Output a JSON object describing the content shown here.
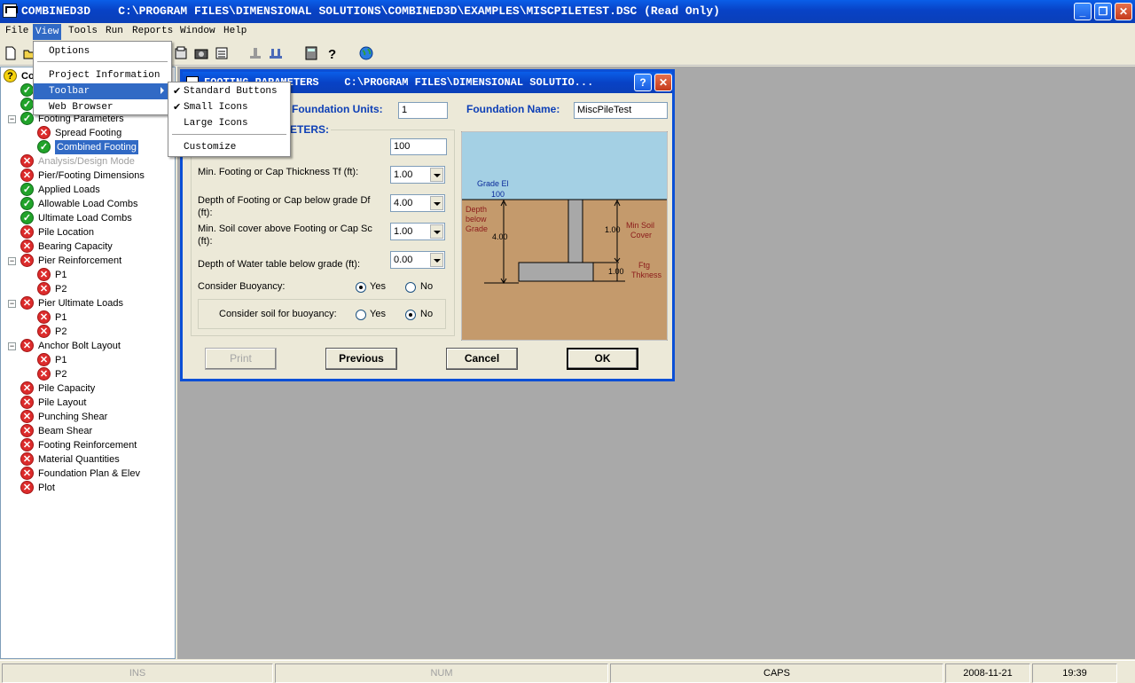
{
  "window": {
    "title": "COMBINED3D    C:\\PROGRAM FILES\\DIMENSIONAL SOLUTIONS\\COMBINED3D\\EXAMPLES\\MISCPILETEST.DSC (Read Only)"
  },
  "menubar": [
    "File",
    "View",
    "Tools",
    "Run",
    "Reports",
    "Window",
    "Help"
  ],
  "view_menu": {
    "items": [
      "Options",
      "Project Information",
      "Toolbar",
      "Web Browser"
    ]
  },
  "toolbar_submenu": {
    "items": [
      {
        "label": "Standard Buttons",
        "checked": true
      },
      {
        "label": "Small Icons",
        "checked": true
      },
      {
        "label": "Large Icons",
        "checked": false
      },
      {
        "label": "Customize",
        "checked": false
      }
    ]
  },
  "tree": {
    "root": "Co",
    "items": [
      {
        "label": "Footing Parameters",
        "status": "ok",
        "level": 1
      },
      {
        "label": "Spread Footing",
        "status": "x",
        "level": 2
      },
      {
        "label": "Combined Footing",
        "status": "ok",
        "level": 2
      },
      {
        "label": "Analysis/Design Mode",
        "status": "x",
        "level": 1
      },
      {
        "label": "Pier/Footing Dimensions",
        "status": "x",
        "level": 1
      },
      {
        "label": "Applied Loads",
        "status": "ok",
        "level": 1
      },
      {
        "label": "Allowable Load Combs",
        "status": "ok",
        "level": 1
      },
      {
        "label": "Ultimate Load Combs",
        "status": "ok",
        "level": 1
      },
      {
        "label": "Pile Location",
        "status": "x",
        "level": 1
      },
      {
        "label": "Bearing Capacity",
        "status": "x",
        "level": 1
      },
      {
        "label": "Pier Reinforcement",
        "status": "x",
        "level": 1
      },
      {
        "label": "P1",
        "status": "x",
        "level": 2
      },
      {
        "label": "P2",
        "status": "x",
        "level": 2
      },
      {
        "label": "Pier Ultimate Loads",
        "status": "x",
        "level": 1
      },
      {
        "label": "P1",
        "status": "x",
        "level": 2
      },
      {
        "label": "P2",
        "status": "x",
        "level": 2
      },
      {
        "label": "Anchor Bolt Layout",
        "status": "x",
        "level": 1
      },
      {
        "label": "P1",
        "status": "x",
        "level": 2
      },
      {
        "label": "P2",
        "status": "x",
        "level": 2
      },
      {
        "label": "Pile Capacity",
        "status": "x",
        "level": 1
      },
      {
        "label": "Pile Layout",
        "status": "x",
        "level": 1
      },
      {
        "label": "Punching Shear",
        "status": "x",
        "level": 1
      },
      {
        "label": "Beam Shear",
        "status": "x",
        "level": 1
      },
      {
        "label": "Footing Reinforcement",
        "status": "x",
        "level": 1
      },
      {
        "label": "Material Quantities",
        "status": "x",
        "level": 1
      },
      {
        "label": "Foundation Plan & Elev",
        "status": "x",
        "level": 1
      },
      {
        "label": "Plot",
        "status": "x",
        "level": 1
      }
    ]
  },
  "dialog": {
    "title": "FOOTING PARAMETERS    C:\\PROGRAM FILES\\DIMENSIONAL SOLUTIO...",
    "units_label": "Foundation Units:",
    "units_value": "1",
    "name_label": "Foundation Name:",
    "name_value": "MiscPileTest",
    "group_title": "ETERS:",
    "grade_value": "100",
    "thickness_label": "Min. Footing or Cap Thickness Tf (ft):",
    "thickness_value": "1.00",
    "depth_label_1": "Depth of Footing or Cap below grade Df",
    "depth_label_2": "(ft):",
    "depth_value": "4.00",
    "cover_label_1": "Min. Soil cover above Footing or Cap Sc",
    "cover_label_2": "(ft):",
    "cover_value": "1.00",
    "water_label": "Depth of Water table below grade (ft):",
    "water_value": "0.00",
    "buoyancy_label": "Consider Buoyancy:",
    "yes": "Yes",
    "no": "No",
    "soil_buoyancy_label": "Consider soil for buoyancy:",
    "buttons": {
      "print": "Print",
      "previous": "Previous",
      "cancel": "Cancel",
      "ok": "OK"
    },
    "diagram": {
      "grade_el": "Grade El",
      "grade_val": "100",
      "depth_below": "Depth",
      "depth_below2": "below",
      "depth_below3": "Grade",
      "depth_val": "4.00",
      "cover_val": "1.00",
      "min_soil": "Min Soil",
      "min_soil2": "Cover",
      "ftg_val": "1.00",
      "ftg": "Ftg",
      "ftg2": "Thkness",
      "sky_color": "#a4d0e4",
      "soil_color": "#c49a6c"
    }
  },
  "statusbar": {
    "ins": "INS",
    "num": "NUM",
    "caps": "CAPS",
    "date": "2008-11-21",
    "time": "19:39"
  }
}
